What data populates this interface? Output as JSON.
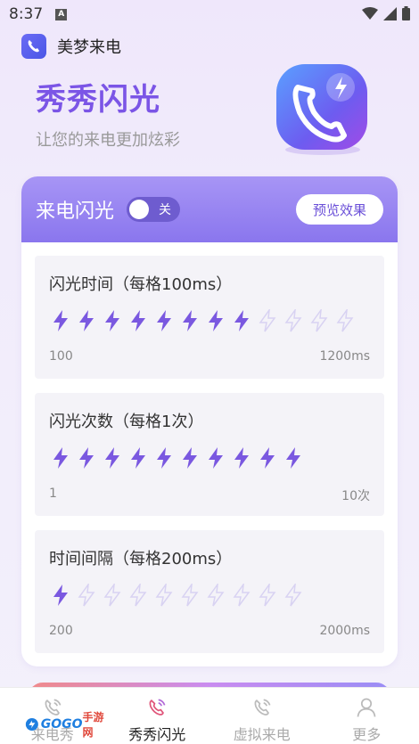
{
  "status_bar": {
    "time": "8:37",
    "a_badge": "A"
  },
  "app": {
    "name": "美梦来电"
  },
  "hero": {
    "title": "秀秀闪光",
    "subtitle": "让您的来电更加炫彩"
  },
  "flash_card": {
    "title": "来电闪光",
    "toggle_label": "关",
    "toggle_on": false,
    "preview_label": "预览效果",
    "sections": [
      {
        "label": "闪光时间（每格100ms）",
        "min": "100",
        "max": "1200ms",
        "filled": 8,
        "total": 12
      },
      {
        "label": "闪光次数（每格1次）",
        "min": "1",
        "max": "10次",
        "filled": 10,
        "total": 10
      },
      {
        "label": "时间间隔（每格200ms）",
        "min": "200",
        "max": "2000ms",
        "filled": 1,
        "total": 10
      }
    ]
  },
  "tabs": [
    {
      "label": "来电秀",
      "icon": "phone-ring-icon",
      "active": false
    },
    {
      "label": "秀秀闪光",
      "icon": "phone-ring-icon",
      "active": true
    },
    {
      "label": "虚拟来电",
      "icon": "phone-ring-icon",
      "active": false
    },
    {
      "label": "更多",
      "icon": "person-icon",
      "active": false
    }
  ],
  "watermark": {
    "text": "GOGO",
    "text2": "手游网"
  },
  "colors": {
    "accent": "#7b55e6",
    "header": "#9a86f1",
    "bolt_filled": "#7a58e0",
    "bolt_empty": "#d8d2f2"
  }
}
